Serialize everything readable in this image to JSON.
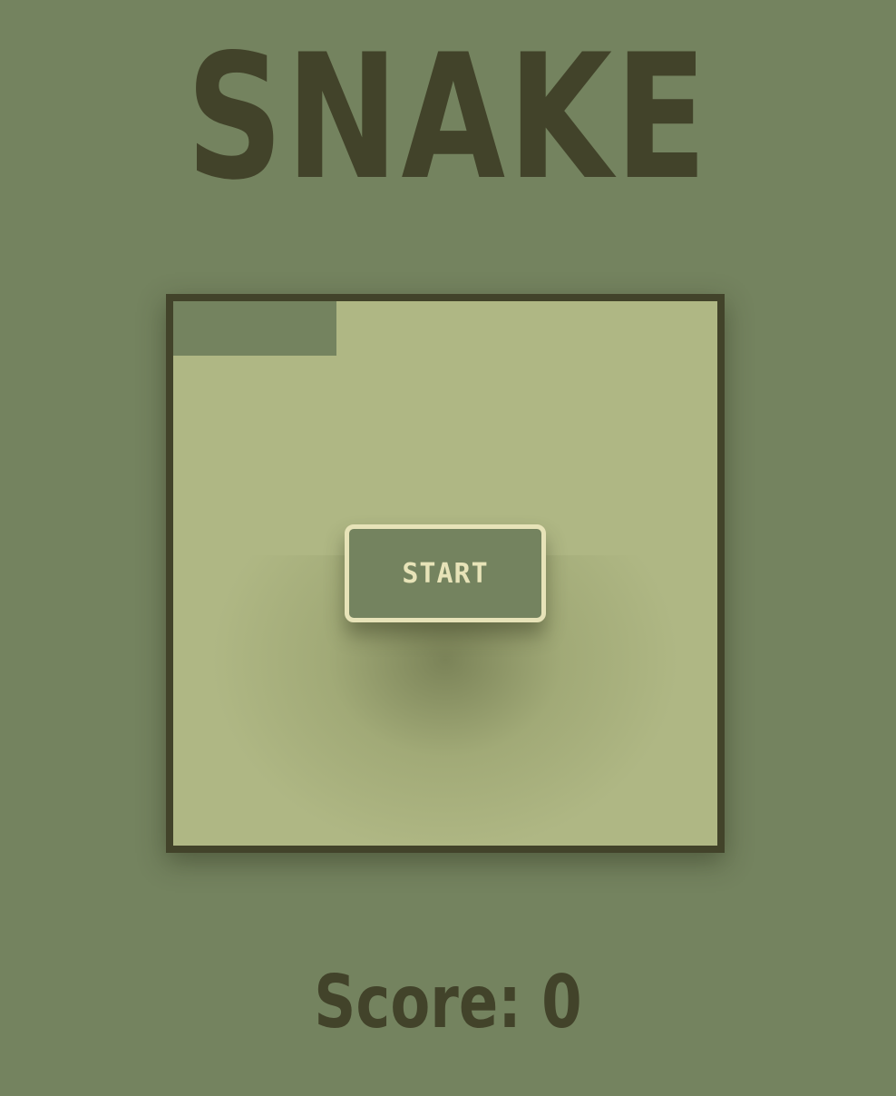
{
  "game": {
    "title": "SNAKE",
    "start_label": "START",
    "score_text": "Score: 0",
    "score_value": 0
  },
  "colors": {
    "background": "#74835f",
    "board": "#afb784",
    "border": "#42432a",
    "snake": "#74835f",
    "button_border": "#e7e3b8",
    "button_text": "#e7e3b8"
  },
  "board": {
    "columns": 20,
    "rows": 20,
    "snake_cells": [
      [
        0,
        0
      ],
      [
        1,
        0
      ],
      [
        2,
        0
      ],
      [
        3,
        0
      ],
      [
        4,
        0
      ],
      [
        5,
        0
      ],
      [
        0,
        1
      ],
      [
        1,
        1
      ],
      [
        2,
        1
      ],
      [
        3,
        1
      ],
      [
        4,
        1
      ],
      [
        5,
        1
      ]
    ]
  }
}
